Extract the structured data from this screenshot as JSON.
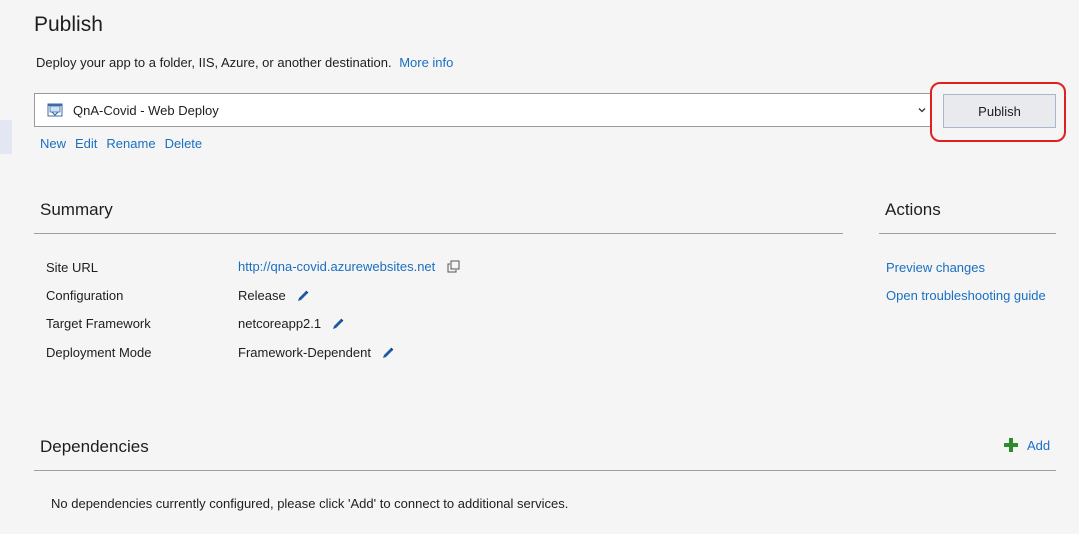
{
  "page": {
    "title": "Publish",
    "description": "Deploy your app to a folder, IIS, Azure, or another destination.",
    "more_info": "More info"
  },
  "profile": {
    "selected": "QnA-Covid - Web Deploy",
    "publish_label": "Publish",
    "actions": [
      "New",
      "Edit",
      "Rename",
      "Delete"
    ]
  },
  "summary": {
    "title": "Summary",
    "rows": [
      {
        "label": "Site URL",
        "value": "http://qna-covid.azurewebsites.net"
      },
      {
        "label": "Configuration",
        "value": "Release"
      },
      {
        "label": "Target Framework",
        "value": "netcoreapp2.1"
      },
      {
        "label": "Deployment Mode",
        "value": "Framework-Dependent"
      }
    ]
  },
  "actions": {
    "title": "Actions",
    "items": [
      "Preview changes",
      "Open troubleshooting guide"
    ]
  },
  "dependencies": {
    "title": "Dependencies",
    "add_label": "Add",
    "empty_message": "No dependencies currently configured, please click 'Add' to connect to additional services."
  },
  "icons": {
    "profile": "web-deploy-icon",
    "dropdown": "chevron-down-icon",
    "copy": "copy-icon",
    "edit": "pencil-icon",
    "add": "plus-icon"
  },
  "colors": {
    "link": "#1a6fc1",
    "highlight": "#e02020",
    "add_plus": "#2e8b2e",
    "edit_pencil": "#1c5aa6"
  }
}
